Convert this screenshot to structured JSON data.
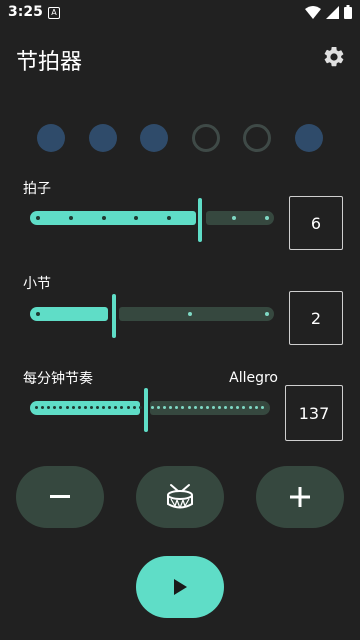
{
  "status_bar": {
    "time": "3:25",
    "notification_icon": "A"
  },
  "app_bar": {
    "title": "节拍器",
    "settings_icon": "gear-icon"
  },
  "beats": [
    {
      "state": "active"
    },
    {
      "state": "active"
    },
    {
      "state": "active"
    },
    {
      "state": "inactive"
    },
    {
      "state": "inactive"
    },
    {
      "state": "active"
    }
  ],
  "beats_per_bar": {
    "label": "拍子",
    "value": "6"
  },
  "bars": {
    "label": "小节",
    "value": "2"
  },
  "tempo": {
    "label": "每分钟节奏",
    "tempo_name": "Allegro",
    "value": "137"
  },
  "controls": {
    "decrease_icon": "minus-icon",
    "drum_icon": "drum-icon",
    "increase_icon": "plus-icon",
    "play_icon": "play-icon"
  },
  "colors": {
    "background": "#212121",
    "accent": "#5fddc7",
    "track_inactive": "#36483f",
    "beat_active": "#2f4b6a"
  }
}
